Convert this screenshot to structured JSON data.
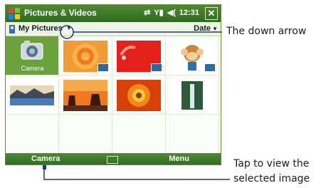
{
  "titlebar": {
    "title": "Pictures & Videos",
    "time": "12:31",
    "close": "✕"
  },
  "toolbar": {
    "folder": "My Pictures",
    "sort": "Date"
  },
  "grid": {
    "camera_label": "Camera"
  },
  "softbar": {
    "left": "Camera",
    "right": "Menu"
  },
  "callouts": {
    "arrow": "The down arrow",
    "tap_line1": "Tap to view the",
    "tap_line2": "selected image"
  }
}
